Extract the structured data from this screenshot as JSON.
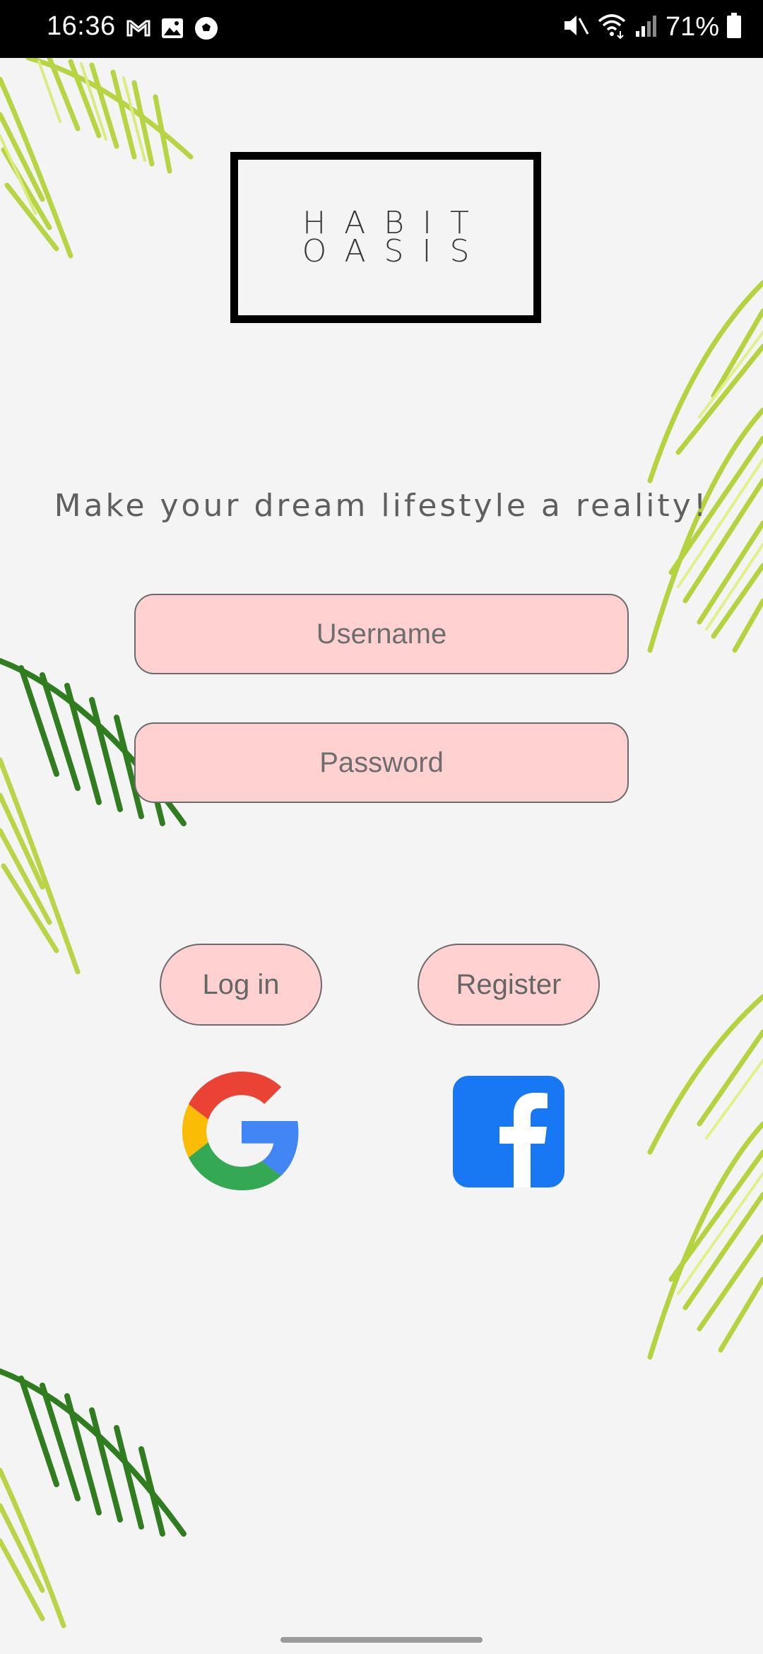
{
  "status_bar": {
    "time": "16:36",
    "battery": "71%",
    "left_icons": [
      "gmail-icon",
      "gallery-icon",
      "soccer-ball-icon"
    ],
    "right_icons": [
      "mute-icon",
      "wifi-icon",
      "signal-icon",
      "battery-icon"
    ]
  },
  "logo": {
    "line1": "HABIT",
    "line2": "OASIS"
  },
  "tagline": "Make your dream lifestyle a reality!",
  "form": {
    "username_placeholder": "Username",
    "username_value": "",
    "password_placeholder": "Password",
    "password_value": ""
  },
  "buttons": {
    "login": "Log in",
    "register": "Register"
  },
  "social": {
    "google": "google-icon",
    "facebook": "facebook-icon"
  },
  "colors": {
    "field_bg": "#ffd1d1",
    "facebook_blue": "#1877f2",
    "leaf_dark": "#2d7a1f",
    "leaf_light": "#c6e05a"
  }
}
